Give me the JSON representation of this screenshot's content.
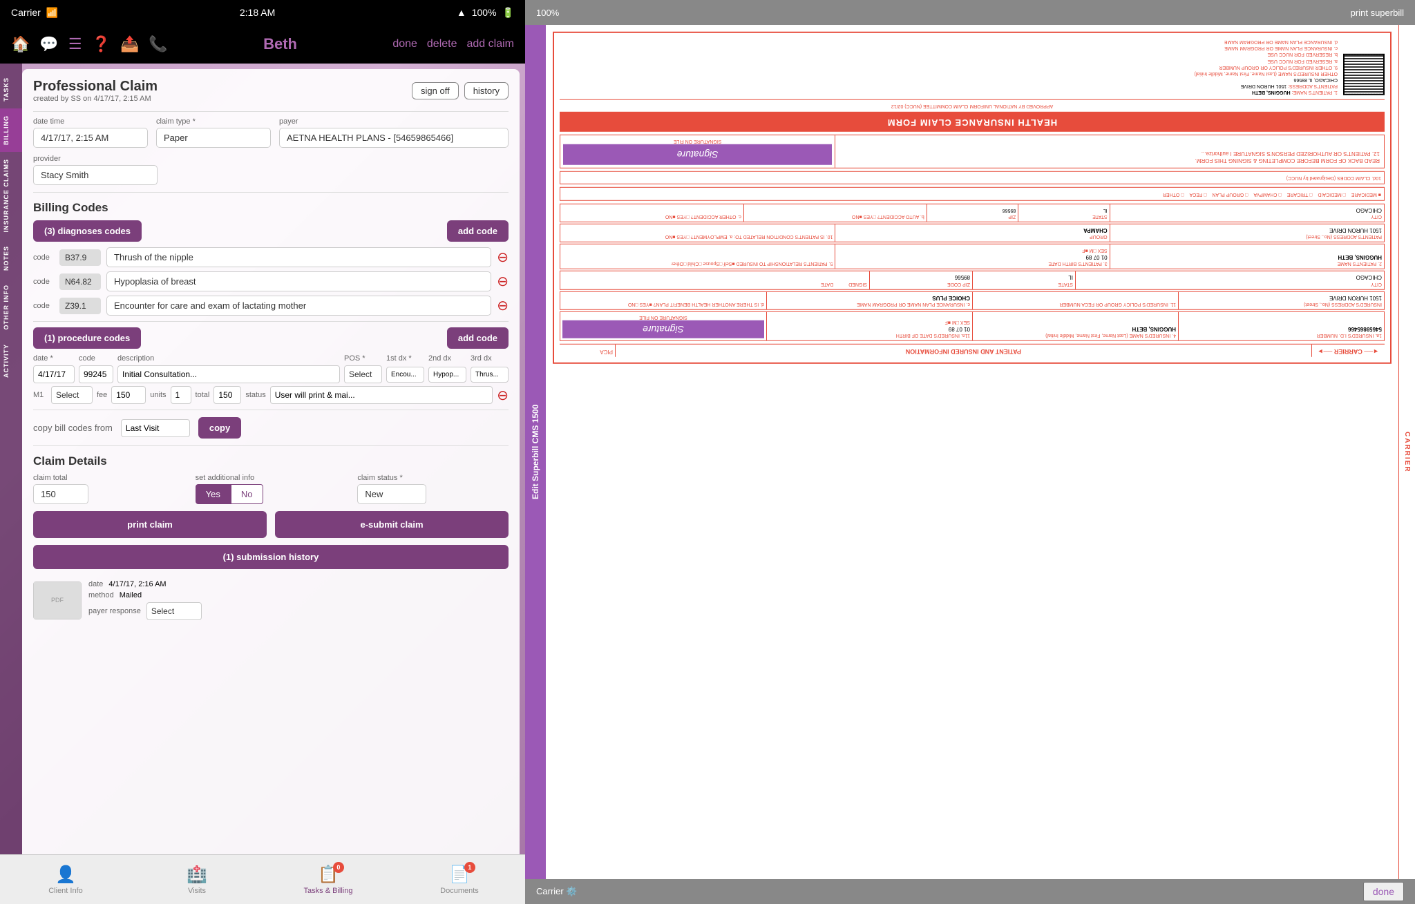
{
  "status_bar": {
    "carrier": "Carrier",
    "wifi": "📶",
    "time": "2:18 AM",
    "location": "▲",
    "battery": "100%"
  },
  "top_nav": {
    "title": "Beth",
    "actions": [
      "done",
      "delete",
      "add claim"
    ],
    "icons": [
      "home",
      "chat",
      "menu",
      "help",
      "share",
      "phone"
    ]
  },
  "side_nav": {
    "items": [
      "TASKS",
      "BILLING",
      "INSURANCE CLAIMS",
      "NOTES",
      "OTHER INFO",
      "ACTIVITY"
    ]
  },
  "form": {
    "title": "Professional Claim",
    "meta": "created by SS on 4/17/17, 2:15 AM",
    "sign_off_label": "sign off",
    "history_label": "history",
    "fields": {
      "date_time_label": "date time",
      "date_time_value": "4/17/17, 2:15 AM",
      "claim_type_label": "claim type *",
      "claim_type_value": "Paper",
      "payer_label": "payer",
      "payer_value": "AETNA HEALTH PLANS - [54659865466]",
      "provider_label": "provider",
      "provider_value": "Stacy Smith"
    },
    "billing_codes": {
      "section_label": "Billing Codes",
      "diagnoses_btn": "(3) diagnoses codes",
      "add_code_btn": "add code",
      "codes": [
        {
          "label": "code",
          "code": "B37.9",
          "description": "Thrush of the nipple"
        },
        {
          "label": "code",
          "code": "N64.82",
          "description": "Hypoplasia of breast"
        },
        {
          "label": "code",
          "code": "Z39.1",
          "description": "Encounter for care and exam of lactating mother"
        }
      ],
      "procedure_btn": "(1) procedure codes",
      "add_procedure_btn": "add code",
      "proc_headers": {
        "date": "date *",
        "code": "code",
        "description": "description",
        "pos": "POS *",
        "dx1": "1st dx *",
        "dx2": "2nd dx",
        "dx3": "3rd dx"
      },
      "proc_row": {
        "date": "4/17/17",
        "code": "99245",
        "description": "Initial Consultation...",
        "pos": "Select",
        "dx1": "Encou...",
        "dx2": "Hypop...",
        "dx3": "Thrus..."
      },
      "proc_m1_label": "M1",
      "proc_m1_value": "Select",
      "proc_fee_label": "fee",
      "proc_fee_value": "150",
      "proc_units_label": "units",
      "proc_units_value": "1",
      "proc_total_label": "total",
      "proc_total_value": "150",
      "proc_status_label": "status",
      "proc_status_value": "User will print & mai..."
    },
    "copy_bill": {
      "label": "copy bill codes from",
      "source_value": "Last Visit",
      "copy_btn": "copy"
    },
    "claim_details": {
      "section_label": "Claim Details",
      "claim_total_label": "claim total",
      "claim_total_value": "150",
      "set_additional_label": "set additional info",
      "yes_label": "Yes",
      "no_label": "No",
      "claim_status_label": "claim status *",
      "claim_status_value": "New",
      "print_btn": "print claim",
      "esubmit_btn": "e-submit claim"
    },
    "submission_history": {
      "section_btn": "(1) submission history",
      "date_label": "date",
      "date_value": "4/17/17, 2:16 AM",
      "method_label": "method",
      "method_value": "Mailed",
      "payer_response_label": "payer response",
      "payer_response_value": "Select"
    }
  },
  "bottom_tabs": {
    "items": [
      {
        "label": "Client Info",
        "icon": "👤",
        "active": false,
        "badge": null
      },
      {
        "label": "Visits",
        "icon": "🏥",
        "active": false,
        "badge": null
      },
      {
        "label": "Tasks & Billing",
        "icon": "📋",
        "active": true,
        "badge": "0"
      },
      {
        "label": "Documents",
        "icon": "📄",
        "active": false,
        "badge": "1"
      }
    ]
  },
  "cms": {
    "top_bar": {
      "zoom": "100%",
      "print_superbill": "print superbill"
    },
    "side_label": "Edit Superbill CMS 1500",
    "bottom_label": "done",
    "title": "HEALTH INSURANCE CLAIM FORM",
    "subtitle": "APPROVED BY NATIONAL UNIFORM CLAIM COMMITTEE (NUCC) 02/12",
    "carrier_label": "CARRIER",
    "patient_info_label": "PATIENT AND INSURED INFORMATION",
    "fields": {
      "insured_id": "54659865466",
      "insured_name": "HUGGINS, BETH",
      "insured_address": "1501 HURON DRIVE",
      "insured_city": "CHICAGO",
      "insured_state": "IL",
      "zip_code": "89566",
      "dob": "01 07 89",
      "insurance_plan": "CHOICE PLUS",
      "patient_name": "HUGGINS, BETH",
      "patient_address": "1501 HURON DRIVE",
      "patient_city": "CHICAGO",
      "patient_state": "IL",
      "patient_zip": "89566",
      "group": "CHAMPA",
      "member": "TRICARE",
      "plan_types": [
        "MEDICARE",
        "MEDICAID",
        "TRICARE",
        "CHAMPVA",
        "GROUP PLAN",
        "FECA",
        "OTHER"
      ]
    },
    "signature_text": "Signature",
    "signature_on_file": "SIGNATURE ON FILE",
    "signed_label": "SIGNED",
    "date_label": "DATE"
  }
}
